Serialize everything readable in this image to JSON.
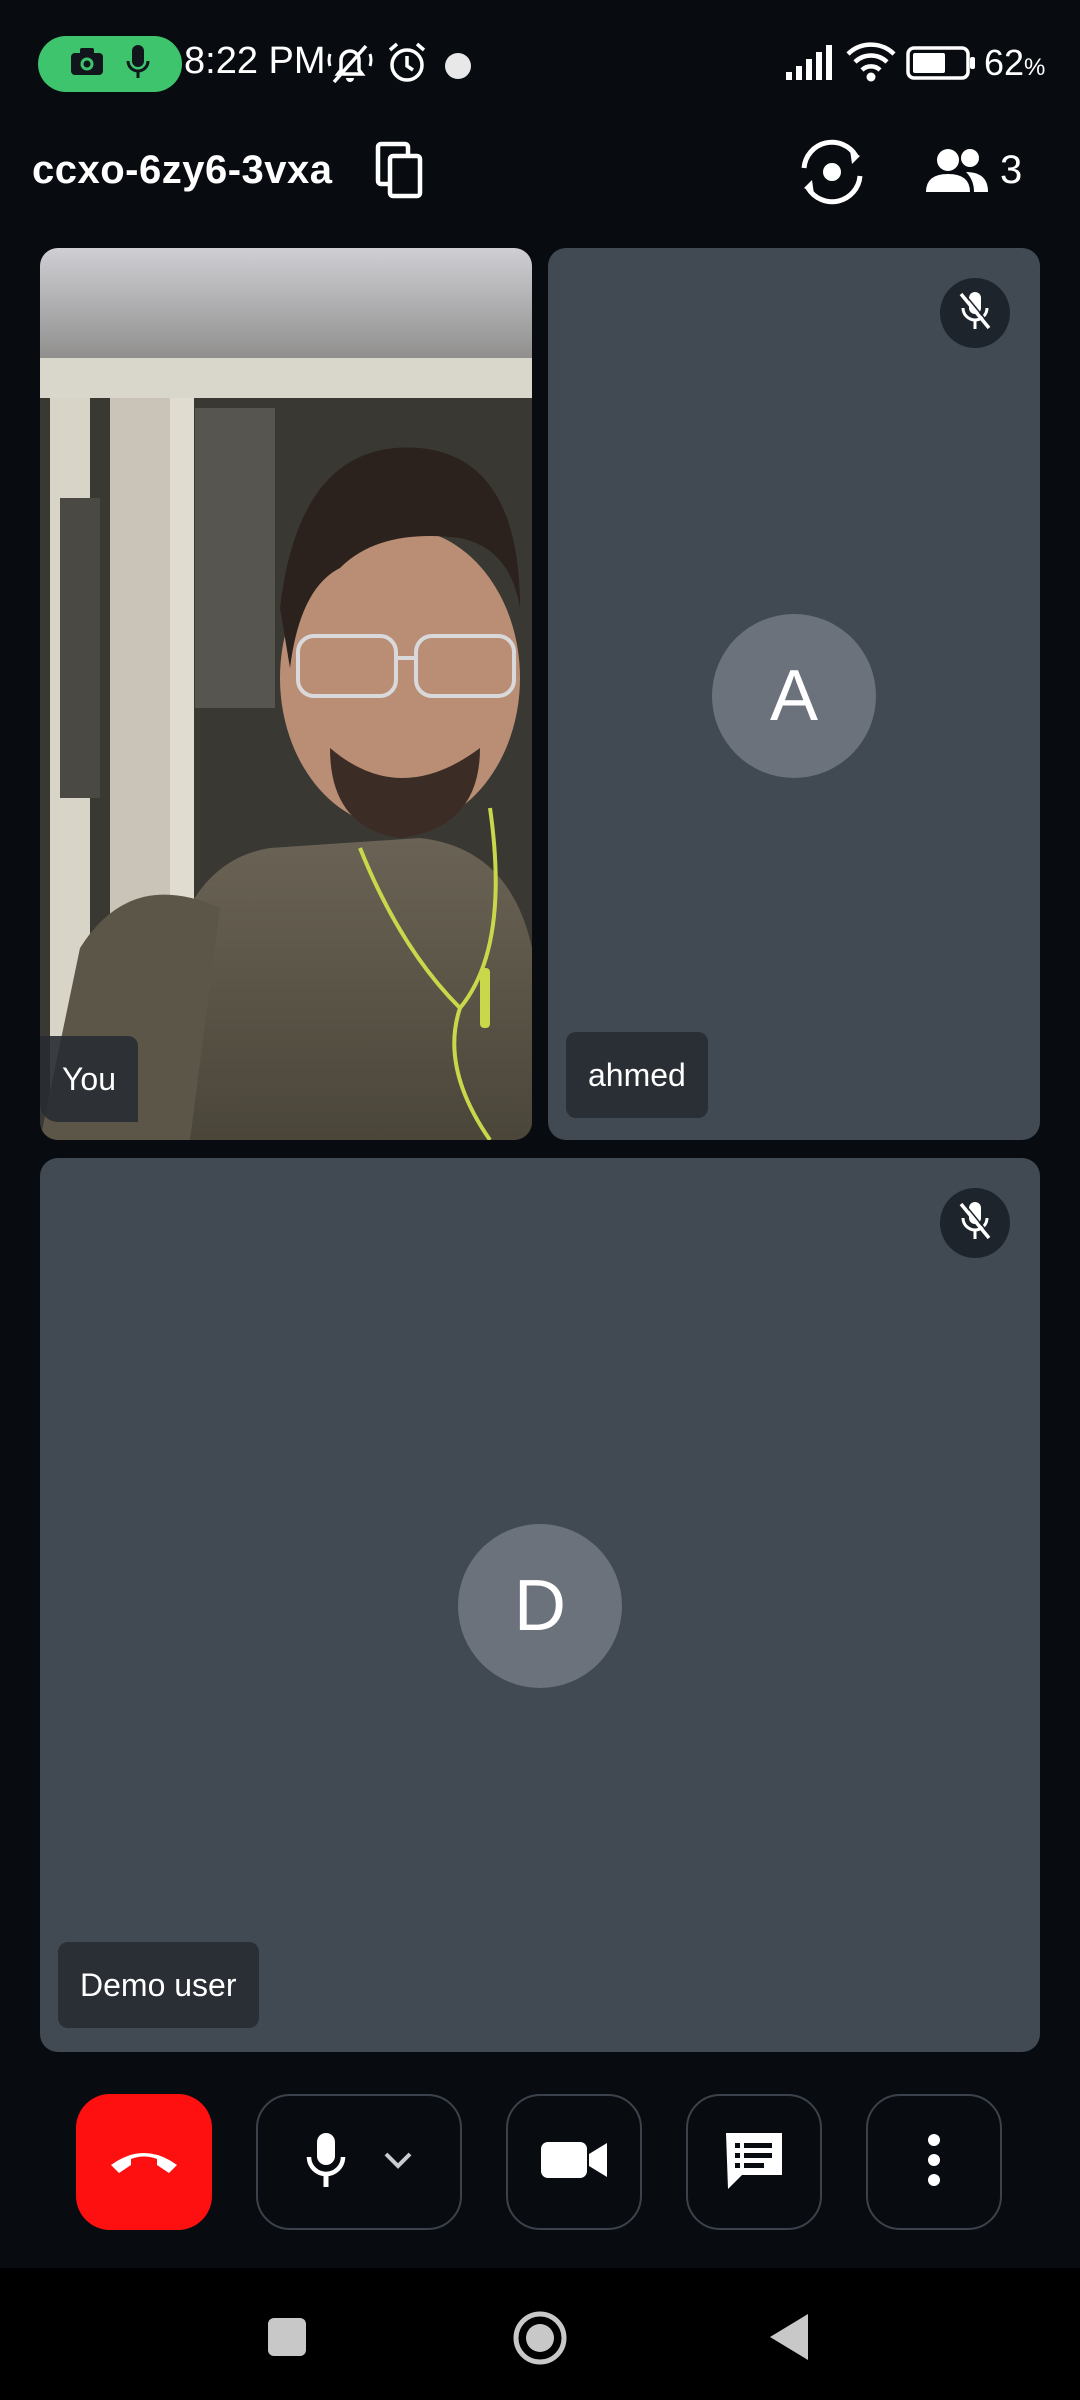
{
  "status_bar": {
    "time": "8:22 PM",
    "battery_percent": "62",
    "battery_suffix": "%",
    "icons": [
      "camera-icon",
      "mic-icon",
      "mute-notifications-icon",
      "alarm-icon",
      "dot-icon",
      "signal-icon",
      "wifi-icon",
      "battery-icon"
    ],
    "pill_color": "#3ec46d"
  },
  "header": {
    "meeting_code": "ccxo-6zy6-3vxa",
    "participant_count": "3",
    "icons": [
      "copy-icon",
      "switch-camera-icon",
      "participants-icon"
    ]
  },
  "tiles": [
    {
      "name": "You",
      "type": "video"
    },
    {
      "name": "ahmed",
      "initial": "A",
      "muted": true
    },
    {
      "name": "Demo user",
      "initial": "D",
      "muted": true
    }
  ],
  "controls": {
    "icons": [
      "end-call-icon",
      "mic-icon",
      "chevron-down-icon",
      "video-camera-icon",
      "chat-icon",
      "more-vert-icon"
    ],
    "end_call_color": "#ff1010"
  },
  "nav_bar": {
    "icons": [
      "recents-square-icon",
      "home-circle-icon",
      "back-triangle-icon"
    ]
  },
  "colors": {
    "background": "#080c11",
    "tile": "#414953",
    "avatar": "#6b727c"
  }
}
